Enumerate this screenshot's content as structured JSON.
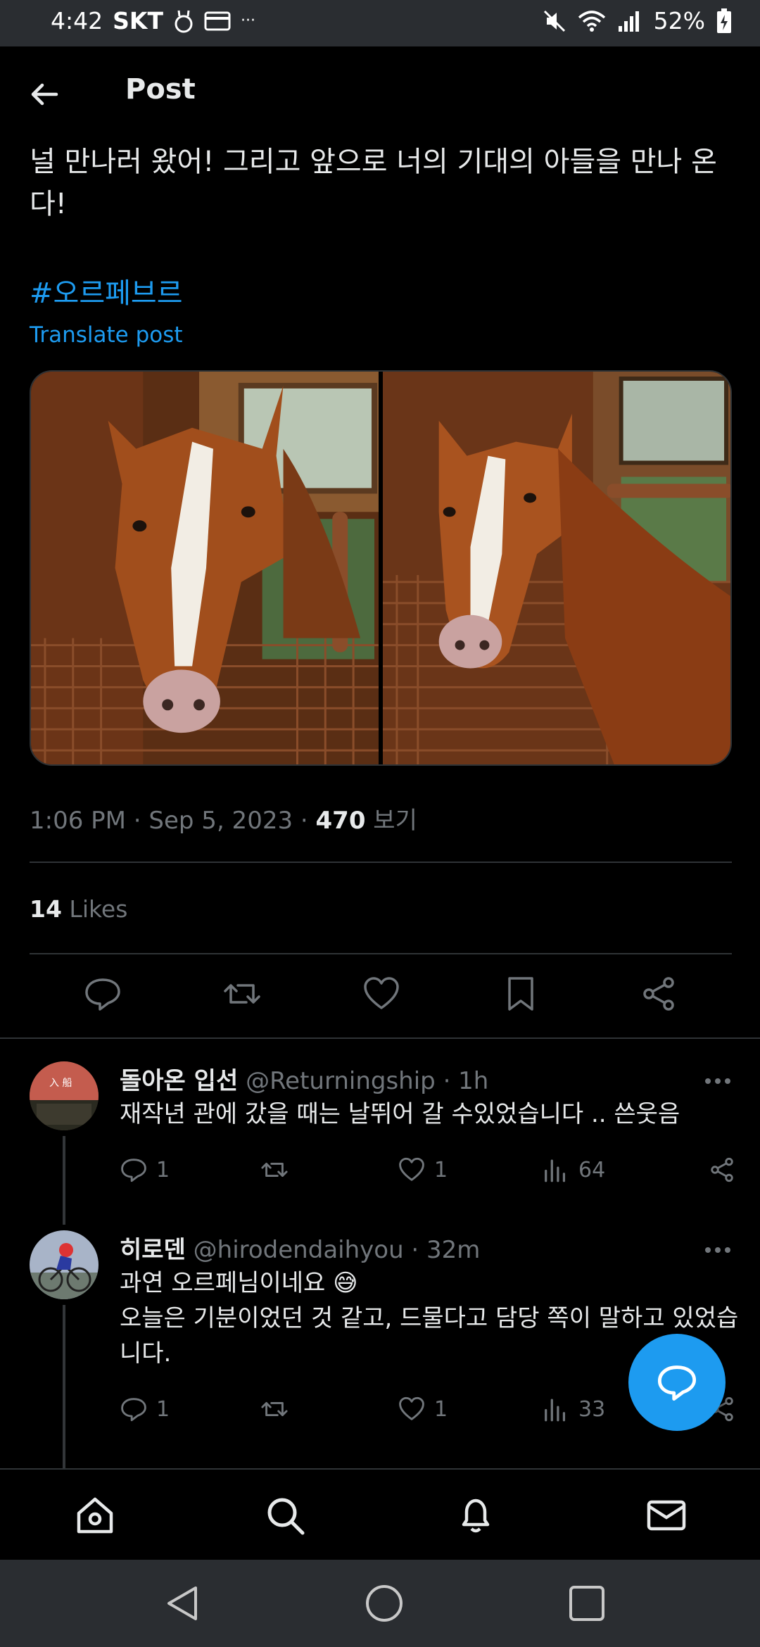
{
  "status_bar": {
    "time": "4:42",
    "carrier": "SKT",
    "more": "···",
    "battery": "52%"
  },
  "header": {
    "title": "Post"
  },
  "post": {
    "text": "널 만나러 왔어! 그리고 앞으로 너의 기대의 아들을 만나 온다!",
    "hashtag": "#오르페브르",
    "translate_label": "Translate post",
    "time": "1:06 PM · Sep 5, 2023 · ",
    "views_count": "470",
    "views_label": " 보기",
    "likes_count": "14",
    "likes_label": " Likes"
  },
  "replies": [
    {
      "name": "돌아온 입선",
      "handle": "@Returningship · 1h",
      "text": "재작년 관에 갔을 때는 날뛰어 갈 수있었습니다 .. 쓴웃음",
      "reply_count": "1",
      "retweet_count": "",
      "like_count": "1",
      "views_count": "64"
    },
    {
      "name": "히로덴",
      "handle": "@hirodendaihyou · 32m",
      "text_line1": "과연 오르페님이네요 😅",
      "text_line2": "오늘은 기분이었던 것 같고, 드물다고 담당 쪽이 말하고 있었습니다.",
      "reply_count": "1",
      "retweet_count": "",
      "like_count": "1",
      "views_count": "33"
    }
  ],
  "icons": {
    "back": "arrow-left-icon",
    "reply": "comment-icon",
    "retweet": "repost-icon",
    "like": "heart-icon",
    "bookmark": "bookmark-icon",
    "share": "share-icon",
    "views": "bar-chart-icon",
    "home": "home-icon",
    "search": "search-icon",
    "notifications": "bell-icon",
    "messages": "mail-icon"
  },
  "colors": {
    "accent": "#1d9bf0",
    "background": "#000000",
    "muted": "#71767b"
  }
}
